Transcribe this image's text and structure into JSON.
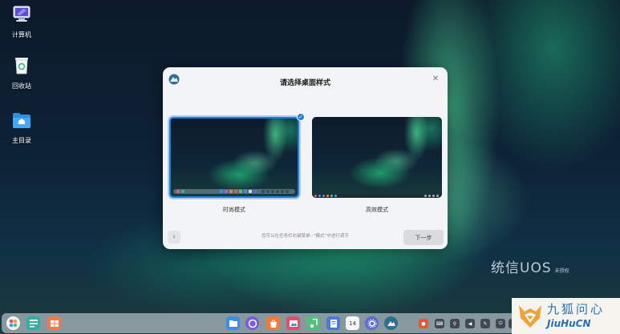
{
  "desktop": {
    "icons": [
      {
        "label": "计算机",
        "icon": "computer-icon"
      },
      {
        "label": "回收站",
        "icon": "trash-icon"
      },
      {
        "label": "主目录",
        "icon": "home-folder-icon"
      }
    ],
    "watermark": {
      "text": "统信UOS",
      "sub": "未授权"
    }
  },
  "dialog": {
    "title": "请选择桌面样式",
    "options": [
      {
        "label": "时尚模式",
        "selected": true
      },
      {
        "label": "高效模式",
        "selected": false
      }
    ],
    "hint": "您可以在任务栏右键菜单--“模式”中进行调节",
    "next_label": "下一步",
    "prev_icon": "chevron-left-icon",
    "close_icon": "close-icon"
  },
  "dock": {
    "left_items": [
      "launcher-icon",
      "multitask-icon",
      "workspace-icon"
    ],
    "apps": [
      "file-manager-icon",
      "browser-icon",
      "app-store-icon",
      "image-viewer-icon",
      "music-icon",
      "document-viewer-icon",
      "calendar-icon",
      "settings-icon",
      "deepin-icon"
    ],
    "calendar_day": "14",
    "tray": [
      "app-tray-icon",
      "keyboard-icon",
      "usb-icon",
      "volume-icon",
      "pen-icon",
      "power-icon",
      "expand-icon"
    ]
  },
  "overlay": {
    "cn": "九狐问心",
    "en": "JiuHuCN"
  },
  "colors": {
    "accent": "#1e7de0",
    "dialog_bg": "#f3f4f6"
  }
}
